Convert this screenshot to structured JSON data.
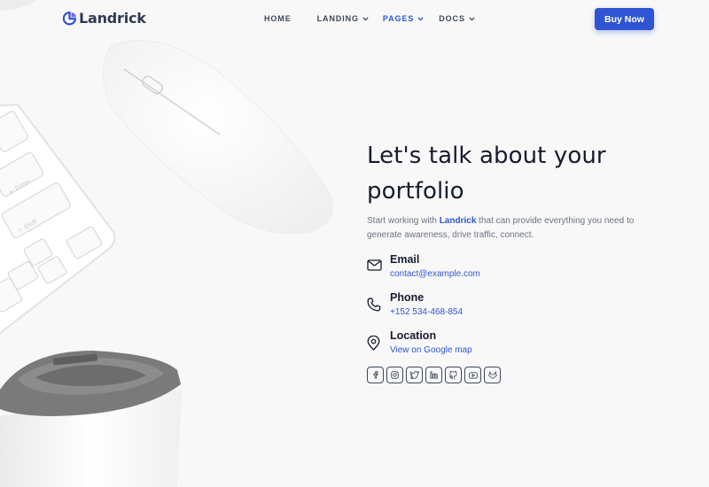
{
  "header": {
    "brand": "Landrick",
    "nav": [
      {
        "label": "HOME",
        "dropdown": false,
        "active": false
      },
      {
        "label": "LANDING",
        "dropdown": true,
        "active": false
      },
      {
        "label": "PAGES",
        "dropdown": true,
        "active": true
      },
      {
        "label": "DOCS",
        "dropdown": true,
        "active": false
      }
    ],
    "cta_label": "Buy Now"
  },
  "hero": {
    "headline_line1": "Let's talk about your",
    "headline_line2": "portfolio",
    "intro_before": "Start working with ",
    "intro_brand": "Landrick",
    "intro_after": " that can provide everything you need to generate awareness, drive traffic, connect."
  },
  "contacts": [
    {
      "icon": "mail-icon",
      "title": "Email",
      "link": "contact@example.com"
    },
    {
      "icon": "phone-icon",
      "title": "Phone",
      "link": "+152 534-468-854"
    },
    {
      "icon": "map-pin-icon",
      "title": "Location",
      "link": "View on Google map"
    }
  ],
  "social": [
    "facebook-icon",
    "instagram-icon",
    "twitter-icon",
    "linkedin-icon",
    "github-icon",
    "youtube-icon",
    "gitlab-icon"
  ],
  "colors": {
    "primary": "#2f55d4",
    "heading": "#161c2d",
    "muted": "#6b7382",
    "background": "#f8f8f8"
  }
}
